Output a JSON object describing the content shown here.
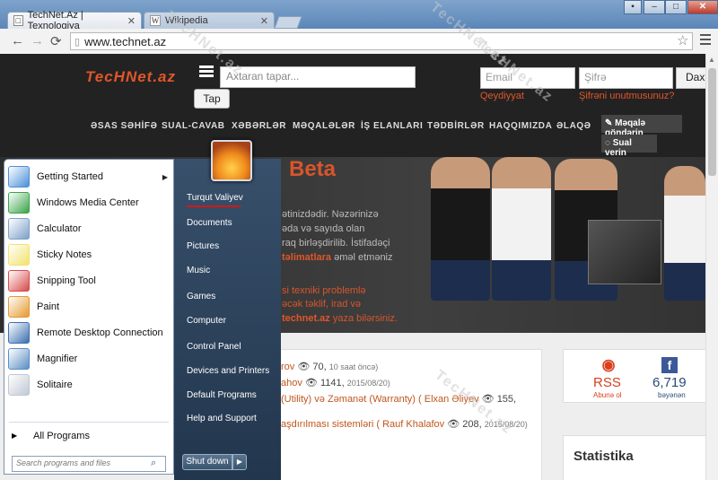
{
  "browser": {
    "tabs": [
      {
        "title": "TechNet.Az | Texnologiya",
        "active": true
      },
      {
        "title": "Wikipedia",
        "active": false
      }
    ],
    "url": "www.technet.az",
    "wikipedia_favicon": "W"
  },
  "site": {
    "logo": "TecHNet.az",
    "search_placeholder": "Axtaran tapar...",
    "search_button": "Tap",
    "email_placeholder": "Email",
    "password_placeholder": "Şifrə",
    "login_button": "Dax",
    "register_link": "Qeydiyyat",
    "forgot_link": "Şifrəni unutmusunuz?",
    "nav": [
      "ƏSAS SƏHİFƏ",
      "SUAL-CAVAB",
      "XƏBƏRLƏR",
      "MƏQALƏLƏR",
      "İŞ ELANLARI",
      "TƏDBİRLƏR",
      "HAQQIMIZDA",
      "ƏLAQƏ"
    ],
    "submit_article": "Məqalə göndərin",
    "ask_question": "Sual verin"
  },
  "hero": {
    "badge": "Beta",
    "lines": [
      "ətinizdədir. Nəzərinizə",
      "əda və sayıda olan",
      "raq birləşdirilib. İstifadəçi"
    ],
    "line4_link": "təlimatlara",
    "line4_rest": " əməl etməniz",
    "line5": "si texniki problemlə",
    "line6": "əcək təklif, irad və",
    "line7_link": "technet.az",
    "line7_rest": " yaza bilərsiniz."
  },
  "posts": [
    {
      "title": "rov",
      "views": "70,",
      "date": "10 saat öncə)"
    },
    {
      "title": "ahov",
      "views": "1141,",
      "date": "2015/08/20)"
    },
    {
      "title": "(Utility) və Zəmanət (Warranty)",
      "author": "( Elxan Əliyev",
      "views": "155,",
      "date": ""
    },
    {
      "title": "aşdırılması sistemləri",
      "author": "( Rauf Khalafov",
      "views": "208,",
      "date": "2015/08/20)"
    }
  ],
  "social": {
    "rss_label": "RSS",
    "rss_sub": "Abunə ol",
    "fb_count": "6,719",
    "fb_sub": "bəyənən",
    "fb_icon_letter": "f"
  },
  "stats_title": "Statistika",
  "start_menu": {
    "programs": [
      {
        "label": "Getting Started",
        "icon": "getting-started-icon",
        "color": "#4a90d9",
        "has_arrow": true
      },
      {
        "label": "Windows Media Center",
        "icon": "media-center-icon",
        "color": "#3aa34a",
        "has_arrow": false
      },
      {
        "label": "Calculator",
        "icon": "calculator-icon",
        "color": "#7da0c8",
        "has_arrow": false
      },
      {
        "label": "Sticky Notes",
        "icon": "sticky-notes-icon",
        "color": "#f2e26b",
        "has_arrow": false
      },
      {
        "label": "Snipping Tool",
        "icon": "snipping-tool-icon",
        "color": "#d84a4a",
        "has_arrow": false
      },
      {
        "label": "Paint",
        "icon": "paint-icon",
        "color": "#e59a2f",
        "has_arrow": false
      },
      {
        "label": "Remote Desktop Connection",
        "icon": "remote-desktop-icon",
        "color": "#3b6fb0",
        "has_arrow": false
      },
      {
        "label": "Magnifier",
        "icon": "magnifier-icon",
        "color": "#5b8ec4",
        "has_arrow": false
      },
      {
        "label": "Solitaire",
        "icon": "solitaire-icon",
        "color": "#c0c8d4",
        "has_arrow": false
      }
    ],
    "all_programs": "All Programs",
    "search_placeholder": "Search programs and files",
    "right_items": [
      "Turqut Valiyev",
      "Documents",
      "Pictures",
      "Music",
      "Games",
      "Computer",
      "Control Panel",
      "Devices and Printers",
      "Default Programs",
      "Help and Support"
    ],
    "shutdown": "Shut down"
  },
  "watermark": "TecHNet.az"
}
